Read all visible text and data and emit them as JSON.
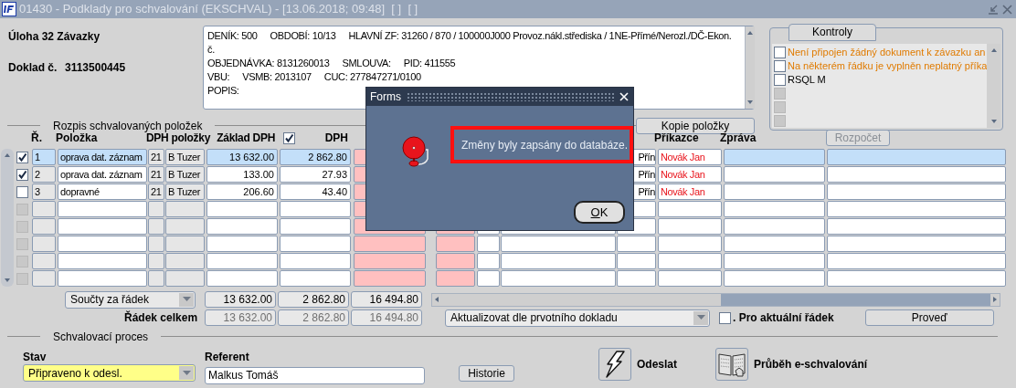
{
  "window": {
    "title": "01430 - Podklady pro schvalování (EKSCHVAL) - [13.06.2018; 09:48]  [ ]  [ ]"
  },
  "header": {
    "task": "Úloha 32 Závazky",
    "doc_label": "Doklad č.",
    "doc_number": "3113500445"
  },
  "info": {
    "lines": [
      [
        "DENÍK: 500",
        "OBDOBÍ: 10/13",
        "HLAVNÍ ZF: 31260 / 870 / 100000J000 Provoz.nákl.střediska / 1NE-Přímé/Nerozl./DČ-Ekon."
      ],
      [
        "č."
      ],
      [
        "OBJEDNÁVKA: 8131260013",
        "SMLOUVA:",
        "PID: 411555"
      ],
      [
        "VBU:",
        "VSMB: 2013107",
        "CUC: 277847271/0100"
      ],
      [
        "POPIS:"
      ]
    ]
  },
  "controls": {
    "tab": "Kontroly",
    "items": [
      {
        "text": "Není připojen žádný dokument k závazku an",
        "checked": false,
        "color": "#e07b00"
      },
      {
        "text": "Na některém řádku je vyplněn neplatný příka",
        "checked": false,
        "color": "#e07b00"
      },
      {
        "text": "RSQL M",
        "checked": false,
        "color": "#000000"
      },
      {
        "kind": "blank",
        "disabled": true
      },
      {
        "kind": "blank",
        "disabled": true
      },
      {
        "kind": "blank",
        "disabled": true
      }
    ]
  },
  "items_section": {
    "title": "Rozpis schvalovaných položek",
    "copy_button": "Kopie položky",
    "budget_button": {
      "label": "Rozpočet",
      "disabled": true
    },
    "columns": [
      {
        "label": "Ř."
      },
      {
        "label": "Položka"
      },
      {
        "label": "DPH položky"
      },
      {
        "label": "Základ DPH"
      },
      {
        "kind": "checkbox",
        "checked": true
      },
      {
        "label": "DPH"
      },
      {
        "label": "Příkazce"
      },
      {
        "label": "Zpráva"
      }
    ],
    "rows": [
      {
        "kind": "item",
        "checked": true,
        "selected": true,
        "cells": [
          "1",
          "oprava dat. záznam",
          "21",
          "B  Tuzer",
          "13 632.00",
          "2 862.80",
          "Přín",
          "Novák Jan"
        ]
      },
      {
        "kind": "item",
        "checked": true,
        "selected": false,
        "cells": [
          "2",
          "oprava dat. záznam",
          "21",
          "B  Tuzer",
          "133.00",
          "27.93",
          "Přín",
          "Novák Jan"
        ]
      },
      {
        "kind": "item",
        "checked": false,
        "selected": false,
        "cells": [
          "3",
          "dopravné",
          "21",
          "B  Tuzer",
          "206.60",
          "43.40",
          "Přín",
          "Novák Jan"
        ]
      },
      {
        "kind": "blank",
        "disabled": true
      },
      {
        "kind": "blank",
        "disabled": true
      },
      {
        "kind": "blank",
        "disabled": true
      },
      {
        "kind": "blank",
        "disabled": true
      },
      {
        "kind": "blank",
        "disabled": true
      }
    ],
    "totals": {
      "mode": "Součty za řádek",
      "values": [
        "13 632.00",
        "2 862.80",
        "16 494.80"
      ]
    },
    "row_total": {
      "label": "Řádek celkem",
      "values": [
        "13 632.00",
        "2 862.80",
        "16 494.80"
      ]
    },
    "update": {
      "value": "Aktualizovat dle prvotního dokladu"
    },
    "current_row": {
      "label": ". Pro aktuální řádek",
      "checked": false
    },
    "run_button": "Proveď"
  },
  "approval": {
    "title": "Schvalovací proces",
    "state_label": "Stav",
    "state": "Připraveno k odesl.",
    "referent_label": "Referent",
    "referent": "Malkus Tomáš",
    "history_button": "Historie",
    "send_button": "Odeslat",
    "progress_button": "Průběh e-schvalování"
  },
  "dialog": {
    "title": "Forms",
    "message": "Změny byly zapsány do databáze.",
    "ok": "OK"
  }
}
